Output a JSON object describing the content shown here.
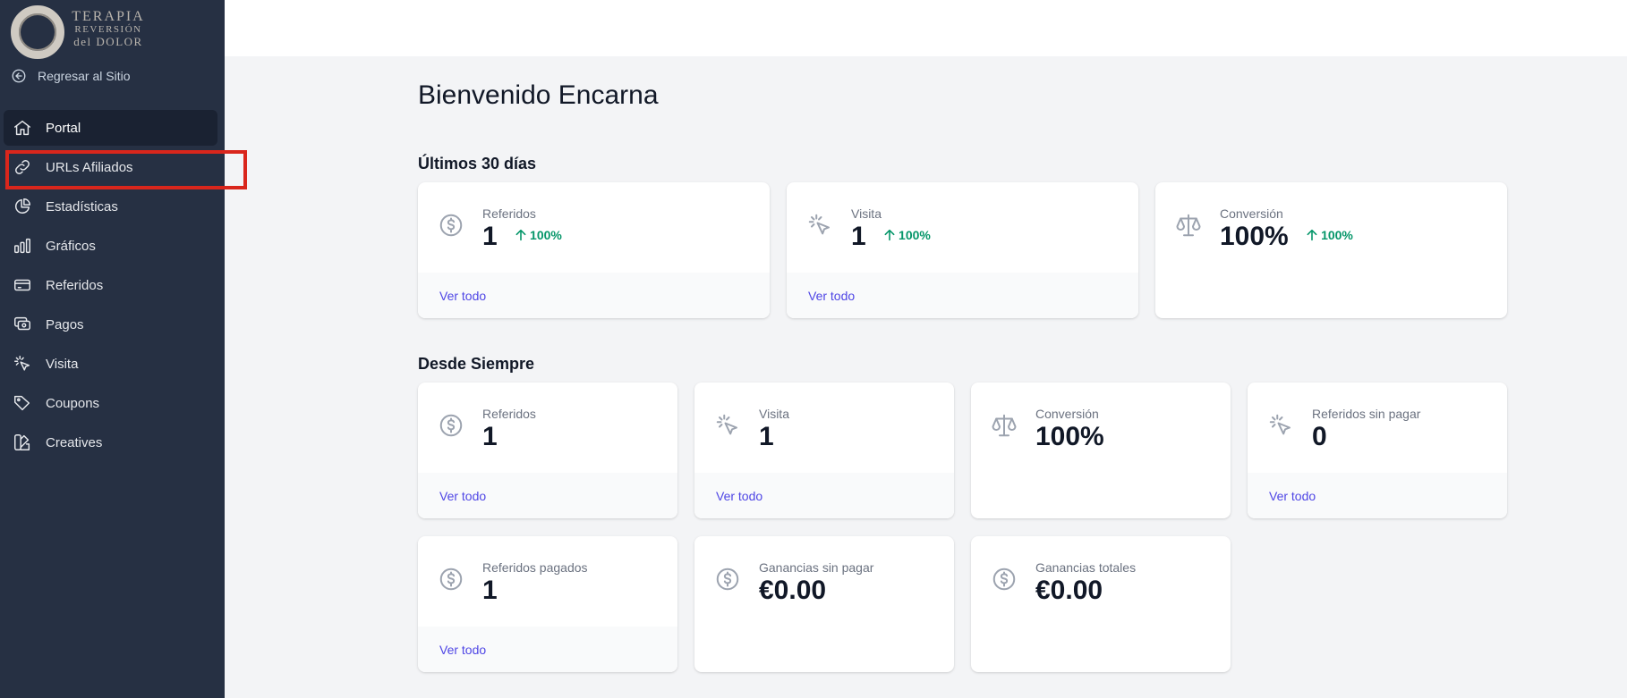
{
  "sidebar": {
    "logo": {
      "line1": "TERAPIA",
      "line2": "REVERSIÓN",
      "line3": "del DOLOR"
    },
    "back_link": "Regresar al Sitio",
    "items": [
      {
        "label": "Portal",
        "icon": "home-icon"
      },
      {
        "label": "URLs Afiliados",
        "icon": "link-icon"
      },
      {
        "label": "Estadísticas",
        "icon": "pie-chart-icon"
      },
      {
        "label": "Gráficos",
        "icon": "bar-chart-icon"
      },
      {
        "label": "Referidos",
        "icon": "credit-card-icon"
      },
      {
        "label": "Pagos",
        "icon": "cash-icon"
      },
      {
        "label": "Visita",
        "icon": "cursor-click-icon"
      },
      {
        "label": "Coupons",
        "icon": "tag-icon"
      },
      {
        "label": "Creatives",
        "icon": "swatch-icon"
      }
    ],
    "active_index": 0,
    "highlighted_index": 1
  },
  "main": {
    "title": "Bienvenido Encarna",
    "last30": {
      "title": "Últimos 30 días",
      "cards": [
        {
          "label": "Referidos",
          "value": "1",
          "trend": "100%",
          "link": "Ver todo",
          "icon": "currency-dollar-icon"
        },
        {
          "label": "Visita",
          "value": "1",
          "trend": "100%",
          "link": "Ver todo",
          "icon": "cursor-click-icon"
        },
        {
          "label": "Conversión",
          "value": "100%",
          "trend": "100%",
          "icon": "scale-icon"
        }
      ]
    },
    "alltime": {
      "title": "Desde Siempre",
      "cards": [
        {
          "label": "Referidos",
          "value": "1",
          "link": "Ver todo",
          "icon": "currency-dollar-icon"
        },
        {
          "label": "Visita",
          "value": "1",
          "link": "Ver todo",
          "icon": "cursor-click-icon"
        },
        {
          "label": "Conversión",
          "value": "100%",
          "icon": "scale-icon"
        },
        {
          "label": "Referidos sin pagar",
          "value": "0",
          "link": "Ver todo",
          "icon": "cursor-click-icon"
        },
        {
          "label": "Referidos pagados",
          "value": "1",
          "link": "Ver todo",
          "icon": "currency-dollar-icon"
        },
        {
          "label": "Ganancias sin pagar",
          "value": "€0.00",
          "icon": "currency-dollar-icon"
        },
        {
          "label": "Ganancias totales",
          "value": "€0.00",
          "icon": "currency-dollar-icon"
        }
      ]
    }
  },
  "colors": {
    "sidebar_bg": "#263043",
    "active_bg": "#1a2232",
    "link": "#4f46e5",
    "trend_up": "#059669",
    "highlight": "#d9261c"
  }
}
